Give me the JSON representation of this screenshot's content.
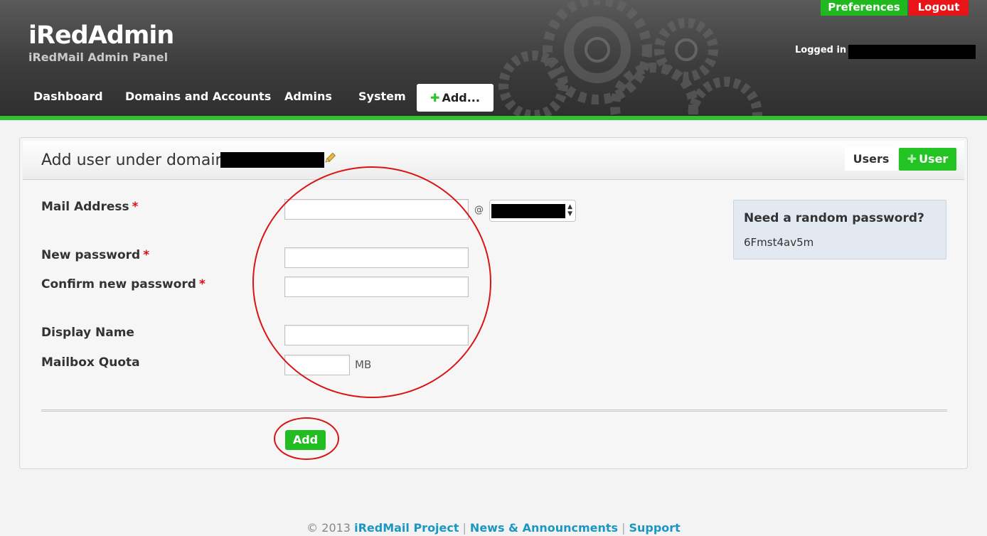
{
  "header": {
    "brand_title": "iRedAdmin",
    "brand_subtitle": "iRedMail Admin Panel",
    "preferences_label": "Preferences",
    "logout_label": "Logout",
    "logged_in_label": "Logged in a",
    "nav": [
      "Dashboard",
      "Domains and Accounts",
      "Admins",
      "System"
    ],
    "nav_add_label": "Add...",
    "colors": {
      "accent_green": "#2fc42f",
      "logout_red": "#e8141a"
    }
  },
  "panel": {
    "title": "Add user under domain:",
    "users_tab_label": "Users",
    "add_user_button_label": "User"
  },
  "form": {
    "mail_address_label": "Mail Address",
    "at_sign": "@",
    "new_password_label": "New password",
    "confirm_password_label": "Confirm new password",
    "display_name_label": "Display Name",
    "mailbox_quota_label": "Mailbox Quota",
    "quota_unit": "MB",
    "required_marker": "*",
    "submit_label": "Add"
  },
  "random_password": {
    "title": "Need a random password?",
    "value": "6Fmst4av5m"
  },
  "footer": {
    "copyright": "© 2013",
    "project_link": "iRedMail Project",
    "news_link": "News & Announcments",
    "support_link": "Support",
    "separator": "|"
  }
}
